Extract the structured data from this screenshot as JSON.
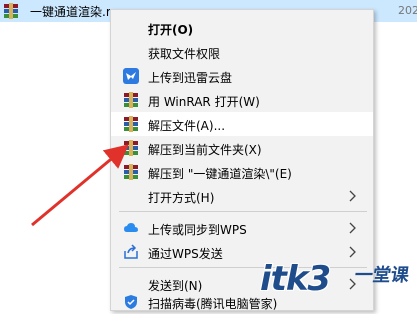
{
  "file": {
    "name": "一键通道渲染.rar",
    "date_partial": "202"
  },
  "menu": {
    "items": [
      {
        "label": "打开(O)",
        "bold": true,
        "icon": "none"
      },
      {
        "label": "获取文件权限",
        "icon": "none"
      },
      {
        "label": "上传到迅雷云盘",
        "icon": "thunder-bird-icon"
      },
      {
        "label": "用 WinRAR 打开(W)",
        "icon": "winrar-icon"
      },
      {
        "label": "解压文件(A)...",
        "icon": "winrar-icon",
        "highlighted": true
      },
      {
        "label": "解压到当前文件夹(X)",
        "icon": "winrar-icon"
      },
      {
        "label": "解压到 \"一键通道渲染\\\"(E)",
        "icon": "winrar-icon"
      },
      {
        "label": "打开方式(H)",
        "icon": "none",
        "submenu": true
      },
      {
        "label": "上传或同步到WPS",
        "icon": "wps-cloud-icon",
        "submenu": true
      },
      {
        "label": "通过WPS发送",
        "icon": "share-icon",
        "submenu": true
      },
      {
        "label": "发送到(N)",
        "icon": "none",
        "submenu": true
      },
      {
        "label": "扫描病毒(腾讯电脑管家)",
        "icon": "shield-icon"
      }
    ]
  },
  "watermark": {
    "latin": "itk3",
    "cjk": "一堂课"
  },
  "colors": {
    "selection": "#cce8ff",
    "menu_bg": "#f2f2f2",
    "annotation_arrow": "#e0312b",
    "winrar_red": "#a01e2a"
  }
}
